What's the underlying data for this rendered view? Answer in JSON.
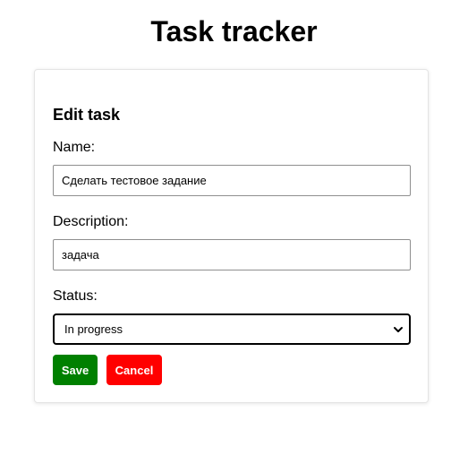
{
  "app": {
    "title": "Task tracker"
  },
  "form": {
    "title": "Edit task",
    "name": {
      "label": "Name:",
      "value": "Сделать тестовое задание"
    },
    "description": {
      "label": "Description:",
      "value": "задача"
    },
    "status": {
      "label": "Status:",
      "selected": "In progress"
    },
    "buttons": {
      "save": "Save",
      "cancel": "Cancel"
    },
    "colors": {
      "save": "#008000",
      "cancel": "#ff0000"
    }
  }
}
